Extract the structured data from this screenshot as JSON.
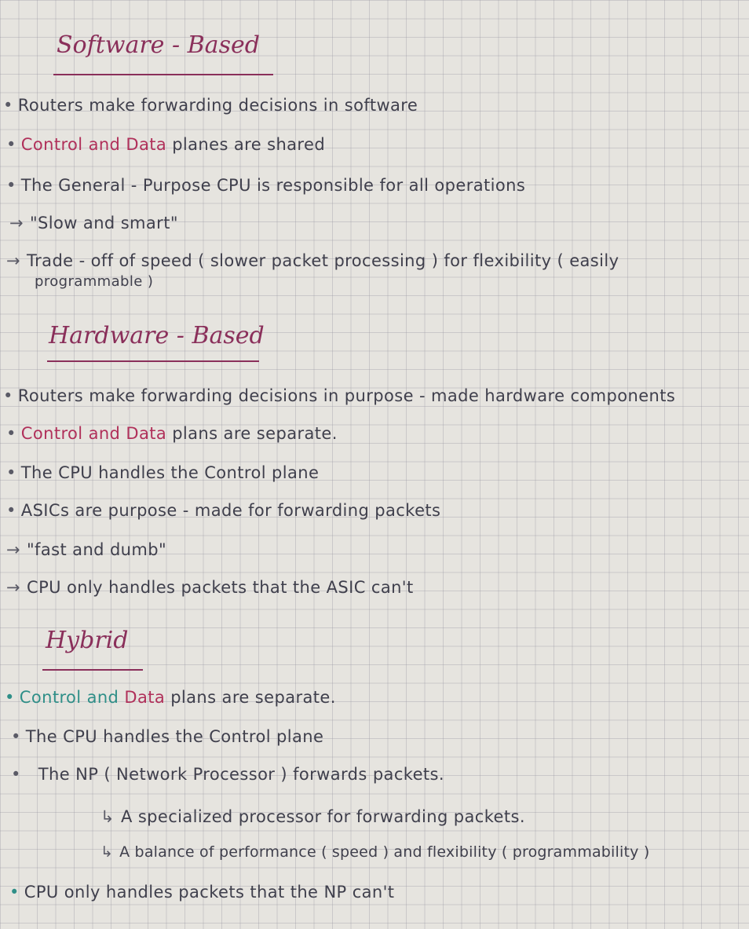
{
  "software": {
    "heading": "Software - Based",
    "l1": "Routers make forwarding decisions in software",
    "l2a": "Control and",
    "l2b": "Data",
    "l2c": "planes are shared",
    "l3": "The General - Purpose CPU is responsible for all operations",
    "l4": "\"Slow and smart\"",
    "l5": "Trade - off of speed ( slower packet processing ) for flexibility ( easily",
    "l6": "programmable )"
  },
  "hardware": {
    "heading": "Hardware - Based",
    "l1": "Routers make forwarding decisions in purpose - made hardware components",
    "l2a": "Control and",
    "l2b": "Data",
    "l2c": "plans are separate.",
    "l3": "The CPU handles the Control plane",
    "l4": "ASICs are purpose - made for forwarding packets",
    "l5": "\"fast and dumb\"",
    "l6": "CPU only handles packets that the ASIC can't"
  },
  "hybrid": {
    "heading": "Hybrid",
    "l1a": "Control and",
    "l1b": "Data",
    "l1c": "plans are separate.",
    "l2": "The CPU handles the Control plane",
    "l3": "The NP ( Network Processor ) forwards packets.",
    "l4": "A specialized processor for forwarding packets.",
    "l5": "A balance of performance ( speed ) and flexibility ( programmability )",
    "l6": "CPU only handles packets that the NP can't"
  },
  "symbols": {
    "bullet": "•",
    "arrow": "→",
    "sub_arrow": "↳"
  },
  "colors": {
    "heading": "#8a2f5a",
    "data_word": "#b0305a",
    "control_bullet": "#2f8f88"
  }
}
